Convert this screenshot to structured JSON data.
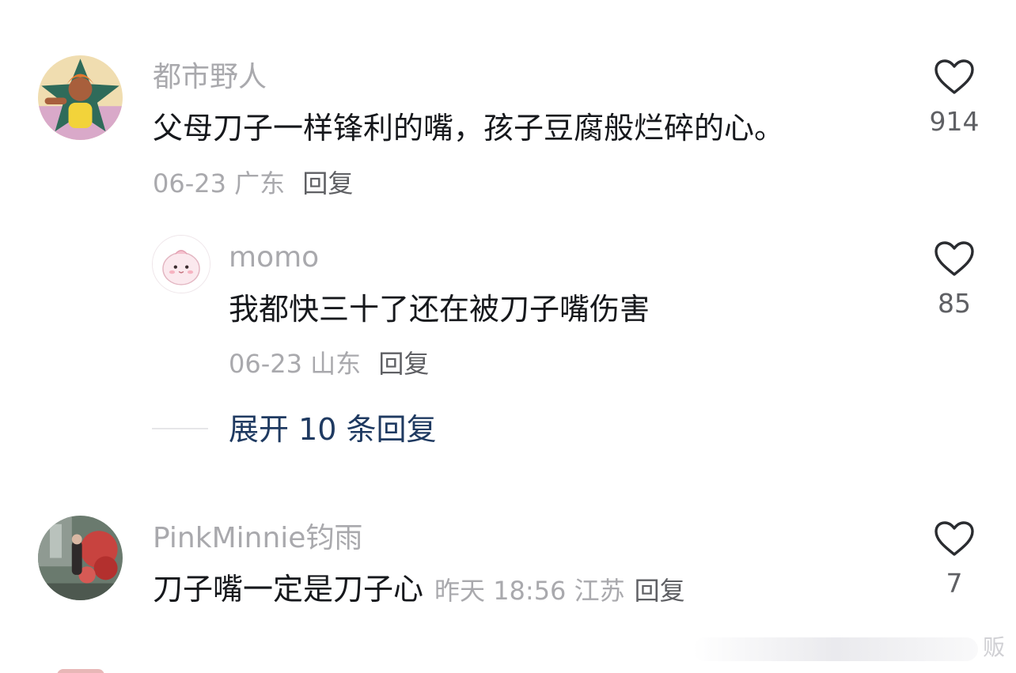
{
  "comments": [
    {
      "username": "都市野人",
      "content": "父母刀子一样锋利的嘴，孩子豆腐般烂碎的心。",
      "date": "06-23",
      "location": "广东",
      "reply_label": "回复",
      "likes": "914"
    },
    {
      "username": "momo",
      "content": "我都快三十了还在被刀子嘴伤害",
      "date": "06-23",
      "location": "山东",
      "reply_label": "回复",
      "likes": "85"
    },
    {
      "username": "PinkMinnie钧雨",
      "content": "刀子嘴一定是刀子心",
      "time": "昨天 18:56",
      "location": "江苏",
      "reply_label": "回复",
      "likes": "7"
    }
  ],
  "expand_replies": "展开 10 条回复",
  "watermark": "贩",
  "icons": {
    "like": "heart-outline-icon"
  },
  "colors": {
    "username": "#a9a9ad",
    "content": "#16181c",
    "expand_link": "#1f3a61"
  }
}
